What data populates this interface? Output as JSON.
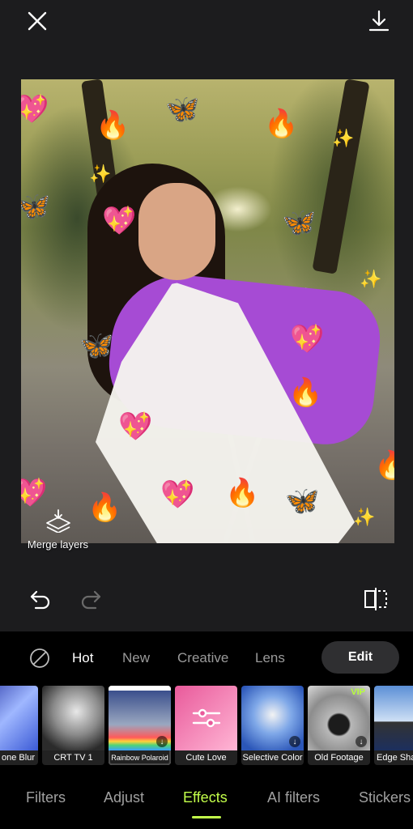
{
  "icons": {
    "close": "close-icon",
    "download": "download-icon",
    "merge": "merge-layers-icon",
    "undo": "undo-icon",
    "redo": "redo-icon",
    "compare": "compare-icon",
    "none": "no-effect-icon"
  },
  "canvas": {
    "merge_label": "Merge layers"
  },
  "categories": {
    "items": [
      "Hot",
      "New",
      "Creative",
      "Lens"
    ],
    "active": "Hot",
    "edit_label": "Edit"
  },
  "effects": [
    {
      "label": "one Blur"
    },
    {
      "label": "CRT TV 1"
    },
    {
      "label": "Rainbow Polaroid"
    },
    {
      "label": "Cute Love"
    },
    {
      "label": "Selective Color"
    },
    {
      "label": "Old Footage",
      "badge": "VIP"
    },
    {
      "label": "Edge Shar"
    }
  ],
  "tabs": {
    "items": [
      "Filters",
      "Adjust",
      "Effects",
      "AI filters",
      "Stickers"
    ],
    "active": "Effects"
  },
  "colors": {
    "accent": "#c3ff4a",
    "background": "#1c1c1e",
    "panel": "#000000"
  }
}
